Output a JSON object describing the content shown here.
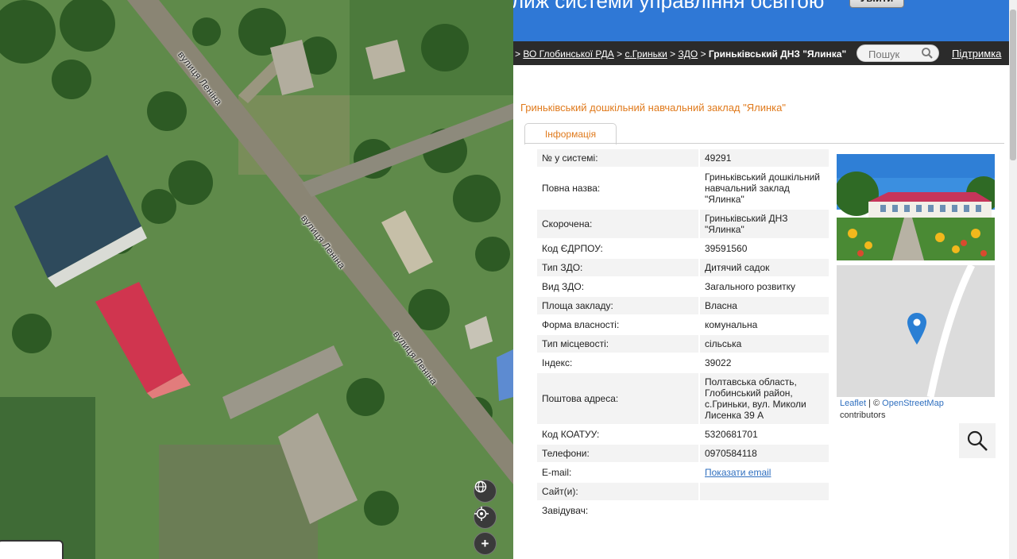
{
  "map": {
    "streets": [
      "вулиця Леніна",
      "вулиця Леніна",
      "вулиця Леніна"
    ],
    "controls": [
      "globe-icon",
      "locate-icon",
      "zoom-in-icon"
    ],
    "zoom_in_label": "+"
  },
  "header": {
    "title_fragment": "лиж системи управління освітою",
    "button_label": "Увійти"
  },
  "breadcrumb": {
    "items": [
      "ВО Глобинської РДА",
      "с.Гриньки",
      "ЗДО"
    ],
    "current": "Гриньківський ДНЗ \"Ялинка\""
  },
  "search": {
    "placeholder": "Пошук"
  },
  "support_link": "Підтримка",
  "page_title": "Гриньківський дошкільний навчальний заклад \"Ялинка\"",
  "tabs": [
    {
      "label": "Інформація",
      "active": true
    }
  ],
  "info": {
    "rows": [
      {
        "key": "№ у системі:",
        "value": "49291"
      },
      {
        "key": "Повна назва:",
        "value": "Гриньківський дошкільний навчальний заклад \"Ялинка\""
      },
      {
        "key": "Скорочена:",
        "value": "Гриньківський ДНЗ \"Ялинка\""
      },
      {
        "key": "Код ЄДРПОУ:",
        "value": "39591560"
      },
      {
        "key": "Тип ЗДО:",
        "value": "Дитячий садок"
      },
      {
        "key": "Вид ЗДО:",
        "value": "Загального розвитку"
      },
      {
        "key": "Площа закладу:",
        "value": "Власна"
      },
      {
        "key": "Форма власності:",
        "value": "комунальна"
      },
      {
        "key": "Тип місцевості:",
        "value": "сільська"
      },
      {
        "key": "Індекс:",
        "value": "39022"
      },
      {
        "key": "Поштова адреса:",
        "value": "Полтавська область, Глобинський район, с.Гриньки, вул. Миколи Лисенка 39 А"
      },
      {
        "key": "Код КОАТУУ:",
        "value": "5320681701"
      },
      {
        "key": "Телефони:",
        "value": "0970584118"
      },
      {
        "key": "E-mail:",
        "value": "Показати email"
      },
      {
        "key": "Сайт(и):",
        "value": ""
      },
      {
        "key": "Завідувач:",
        "value": ""
      }
    ]
  },
  "minimap_attribution": {
    "leaflet": "Leaflet",
    "separator": " | © ",
    "osm": "OpenStreetMap",
    "suffix": "contributors"
  },
  "colors": {
    "header_blue": "#2f78d6",
    "nav_dark": "#2b2b2b",
    "accent_orange": "#e07a1c",
    "link_blue": "#2f6fbf",
    "marker_blue": "#2a7fd4"
  }
}
